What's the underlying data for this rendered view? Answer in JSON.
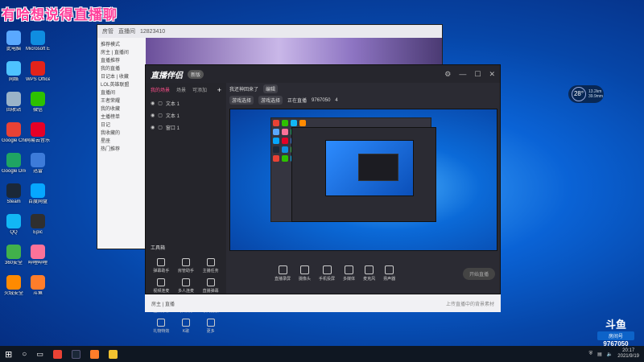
{
  "banner": "有哈想说得直播聊",
  "desktop_icons": [
    {
      "label": "此电脑",
      "color": "#5aa8ff"
    },
    {
      "label": "网络",
      "color": "#4ec3ff"
    },
    {
      "label": "回收站",
      "color": "#9ab3c8"
    },
    {
      "label": "Google Chrome",
      "color": "#e94235"
    },
    {
      "label": "Google Drive",
      "color": "#1fa463"
    },
    {
      "label": "Steam",
      "color": "#1b2838"
    },
    {
      "label": "QQ",
      "color": "#12b7f5"
    },
    {
      "label": "360安全",
      "color": "#41b14b"
    },
    {
      "label": "火绒安全",
      "color": "#ff8a00"
    },
    {
      "label": "Microsoft Edge",
      "color": "#0f8de0"
    },
    {
      "label": "WPS Office",
      "color": "#e2231a"
    },
    {
      "label": "微信",
      "color": "#2dc100"
    },
    {
      "label": "网易云音乐",
      "color": "#e60026"
    },
    {
      "label": "迅雷",
      "color": "#3d7bd9"
    },
    {
      "label": "百度网盘",
      "color": "#06a7ff"
    },
    {
      "label": "Epic",
      "color": "#2f2f2f"
    },
    {
      "label": "哔哩哔哩",
      "color": "#fb7299"
    },
    {
      "label": "斗鱼",
      "color": "#ff7d2a"
    }
  ],
  "back_window": {
    "tabs": [
      "房管",
      "直播间",
      "12823410"
    ],
    "side_items": [
      "推荐模式",
      "房主 | 直播间",
      "直播推荐",
      "我的直播",
      "日记本 | 收藏",
      "LOL英雄联盟",
      "直播间",
      "王者荣耀",
      "我的收藏",
      "主播榜单",
      "日记",
      "我收藏的",
      "星座",
      "热门推荐"
    ]
  },
  "main_window": {
    "app_name": "直播伴侣",
    "version": "新版",
    "tabs": [
      "我的场景",
      "场景",
      "可添加"
    ],
    "layers": [
      "文本 1",
      "文本 1",
      "窗口 1"
    ],
    "room_title": "我还神回来了",
    "room_edit": "编辑",
    "room_tags": [
      "游戏选择",
      "游戏选择"
    ],
    "room_stats": [
      "正在直播",
      "9767050",
      "4"
    ],
    "tools_title": "工具箱",
    "tools": [
      "弹幕助手",
      "房管助手",
      "主播任务",
      "视频连麦",
      "多人连麦",
      "直播弹幕",
      "虚拟形象",
      "弹幕机",
      "歌词播放",
      "礼物特效",
      "K歌",
      "更多"
    ],
    "bottom_controls": [
      "直播录屏",
      "摄像头",
      "手机投屏",
      "多媒体",
      "麦克风",
      "扬声器"
    ],
    "start_button": "开始直播",
    "notice": "上传直播中的背景素材",
    "bottom_strip": [
      "房主 | 直播"
    ]
  },
  "weather": {
    "temp": "28",
    "unit": "°",
    "line1": "13.2km",
    "line2": "39.9mm"
  },
  "douyu": {
    "big": "斗鱼",
    "pill": "房间号",
    "number": "9767050"
  },
  "taskbar": {
    "time": "20:17",
    "date": "2021/9/19"
  }
}
